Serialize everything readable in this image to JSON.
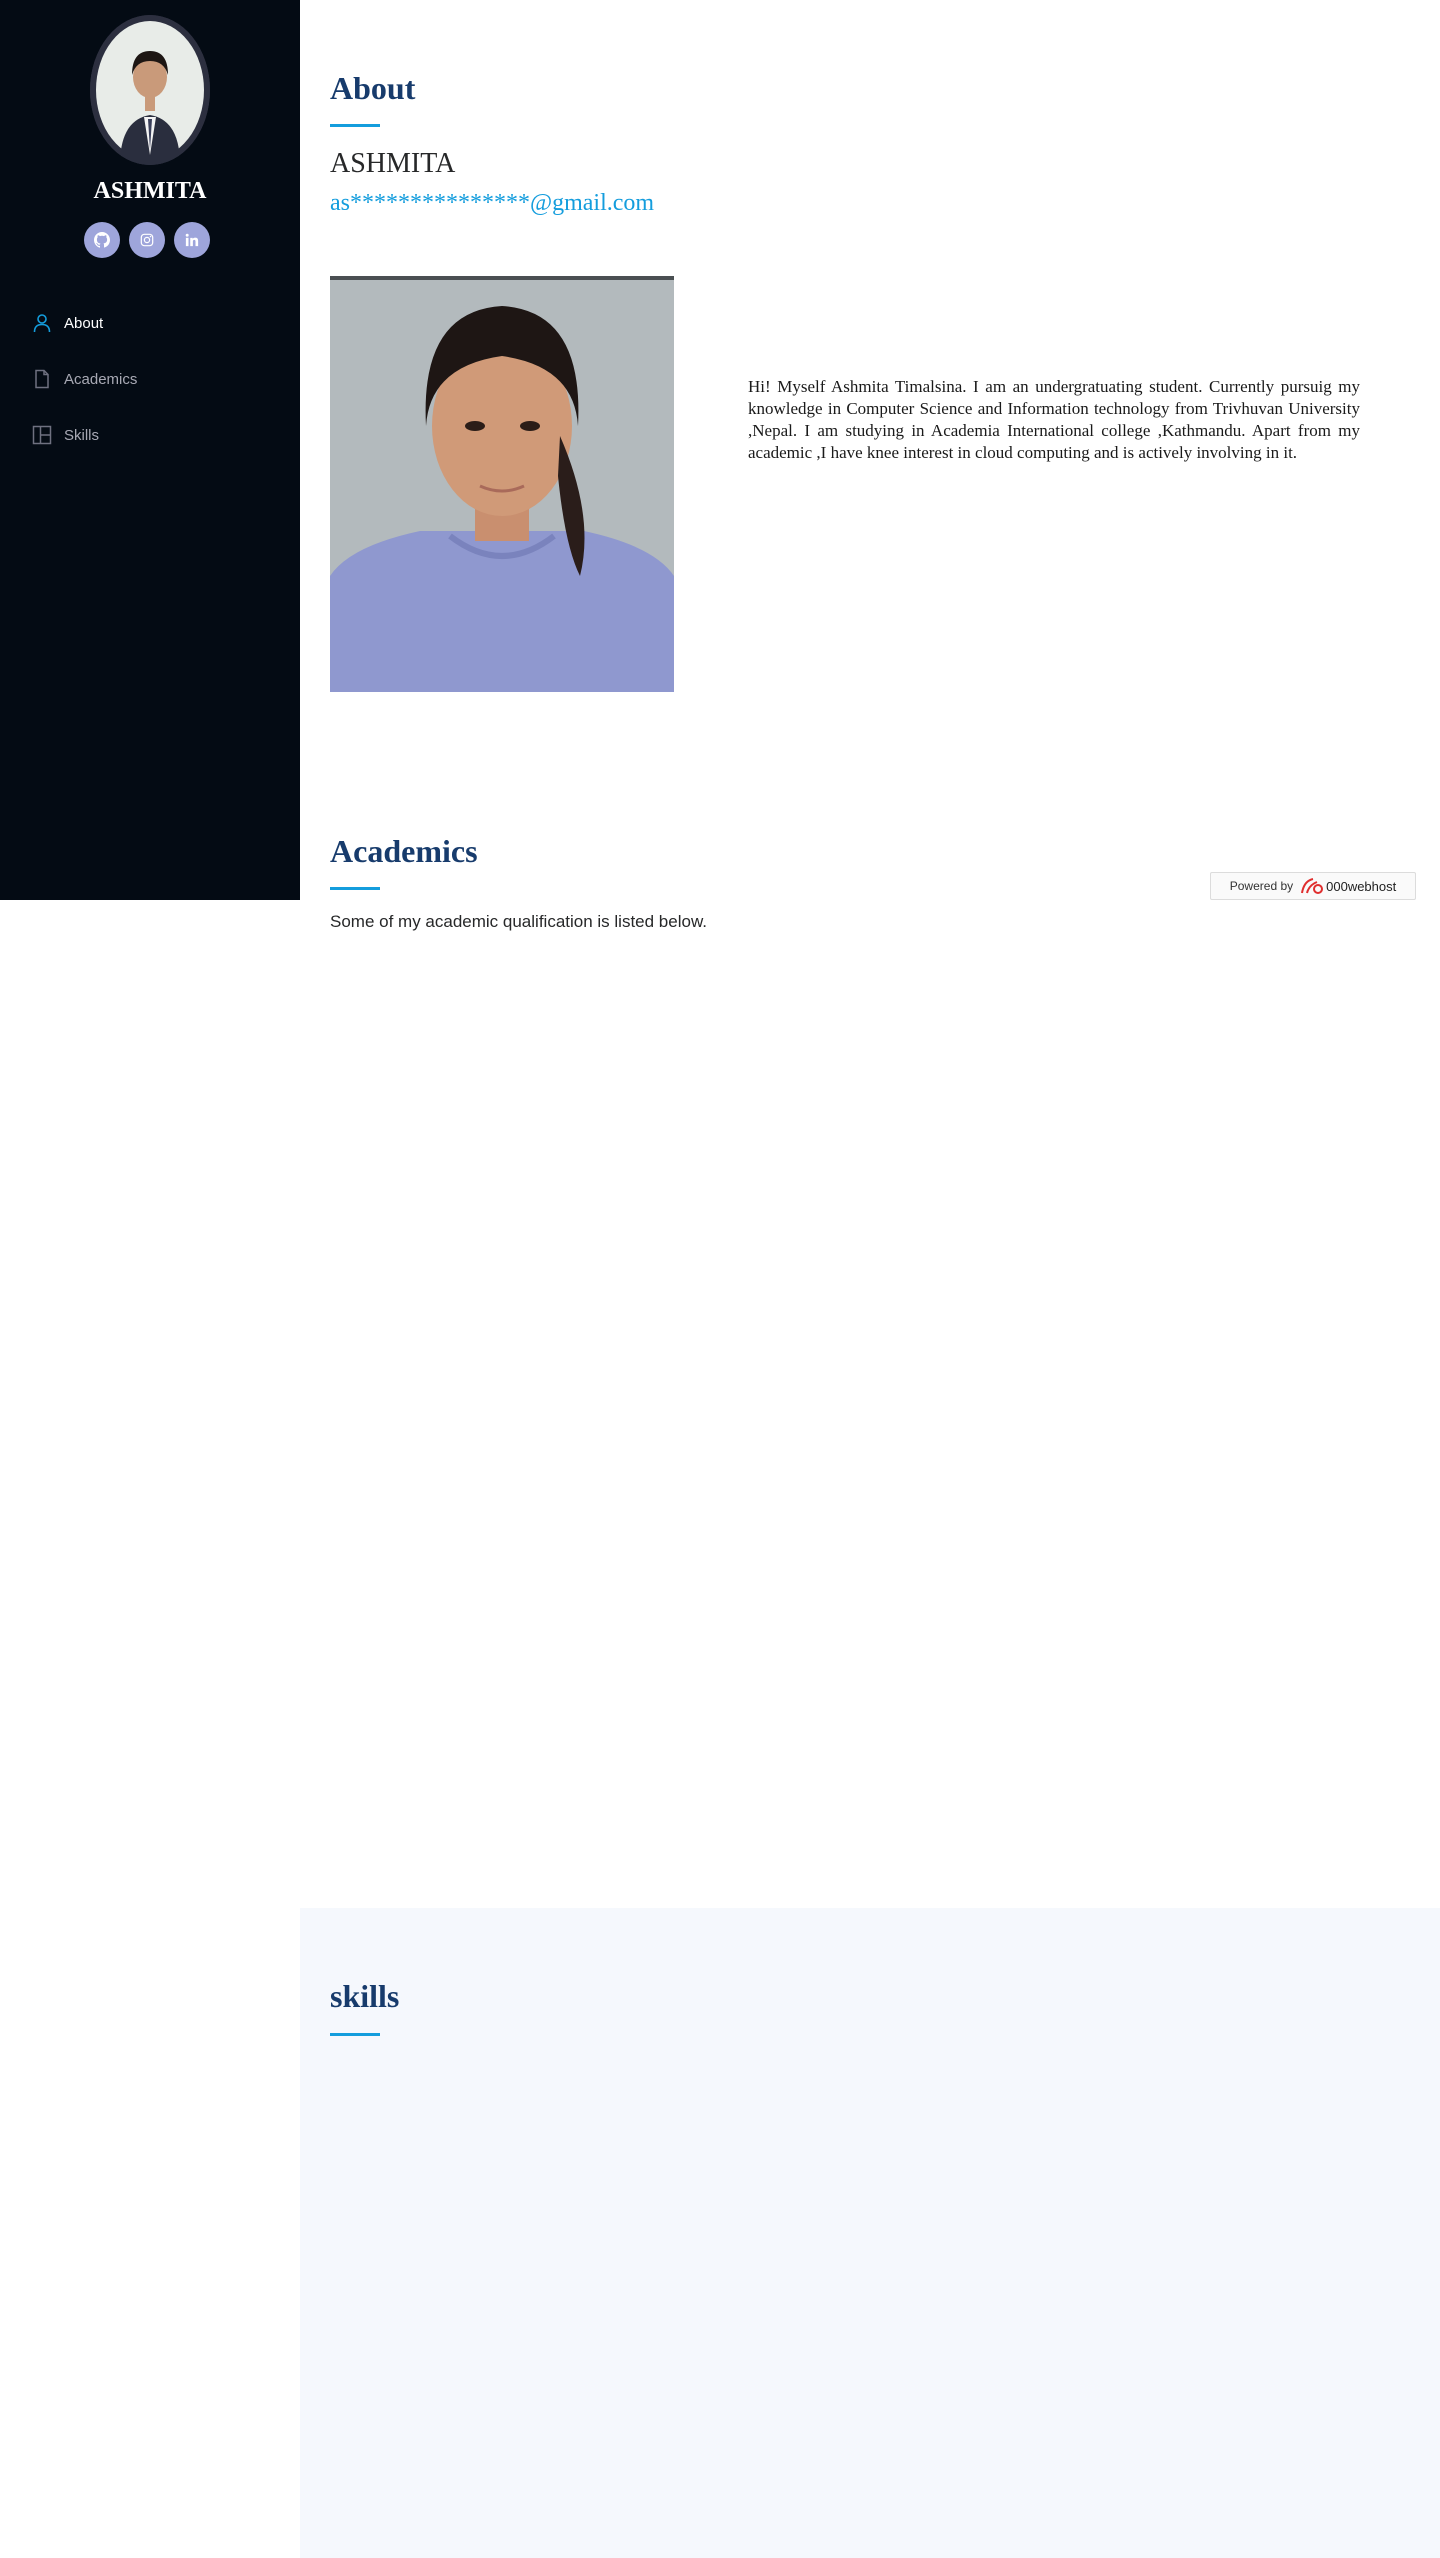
{
  "sidebar": {
    "profile_name": "ASHMITA",
    "social": [
      {
        "icon": "github-icon"
      },
      {
        "icon": "instagram-icon"
      },
      {
        "icon": "linkedin-icon"
      }
    ],
    "nav": [
      {
        "label": "About",
        "icon": "person-icon",
        "active": true
      },
      {
        "label": "Academics",
        "icon": "file-icon",
        "active": false
      },
      {
        "label": "Skills",
        "icon": "layout-icon",
        "active": false
      }
    ]
  },
  "about": {
    "title": "About",
    "name": "ASHMITA",
    "email": "as***************@gmail.com",
    "bio": "Hi! Myself Ashmita Timalsina. I am an undergratuating student. Currently pursuig my knowledge in Computer Science and Information technology from Trivhuvan University ,Nepal. I am studying in Academia International college ,Kathmandu. Apart from my academic ,I have knee interest in cloud computing and is actively involving in it."
  },
  "academics": {
    "title": "Academics",
    "description": "Some of my academic qualification is listed below."
  },
  "skills": {
    "title": "skills"
  },
  "badge": {
    "powered_by": "Powered by",
    "brand": "000webhost"
  },
  "colors": {
    "sidebar_bg": "#040b14",
    "accent": "#149ddd",
    "heading": "#173b6c",
    "social_bg": "#9ea5db",
    "skills_bg": "#f5f8fd"
  }
}
